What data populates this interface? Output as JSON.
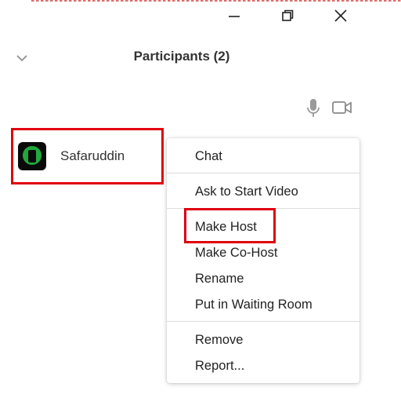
{
  "window": {
    "controls": [
      {
        "name": "minimize-icon"
      },
      {
        "name": "restore-icon"
      },
      {
        "name": "close-icon"
      }
    ]
  },
  "panel": {
    "title": "Participants (2)",
    "collapse_icon": "chevron-down-icon",
    "toolbar_icons": [
      "microphone-icon",
      "video-camera-icon"
    ]
  },
  "participant": {
    "name": "Safaruddin",
    "avatar_colors": {
      "bg": "#0a0a0a",
      "fg": "#1faa3c"
    }
  },
  "context_menu": {
    "items": [
      {
        "label": "Chat"
      },
      {
        "label": "Ask to Start Video"
      },
      {
        "label": "Make Host"
      },
      {
        "label": "Make Co-Host"
      },
      {
        "label": "Rename"
      },
      {
        "label": "Put in Waiting Room"
      },
      {
        "label": "Remove"
      },
      {
        "label": "Report..."
      }
    ]
  },
  "colors": {
    "highlight": "#e0000e",
    "text": "#222222"
  }
}
